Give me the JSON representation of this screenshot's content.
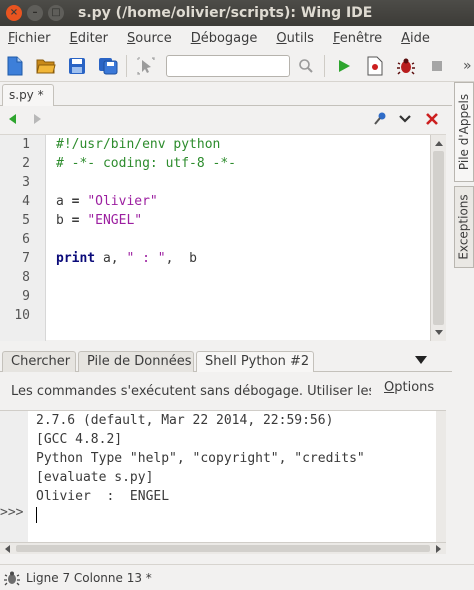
{
  "window": {
    "title": "s.py (/home/olivier/scripts): Wing IDE",
    "close_glyph": "×",
    "minimize_glyph": "–",
    "maximize_glyph": "□"
  },
  "menu": {
    "items": [
      {
        "first": "F",
        "rest": "ichier"
      },
      {
        "first": "E",
        "rest": "diter"
      },
      {
        "first": "S",
        "rest": "ource"
      },
      {
        "first": "D",
        "rest": "ébogage"
      },
      {
        "first": "O",
        "rest": "utils"
      },
      {
        "first": "F",
        "rest": "enêtre"
      },
      {
        "first": "A",
        "rest": "ide"
      }
    ]
  },
  "toolbar": {
    "search_value": "",
    "icons": [
      "new-file-icon",
      "open-folder-icon",
      "save-icon",
      "save-all-icon",
      "select-pointer-icon",
      "search-icon",
      "run-icon",
      "debug-file-icon",
      "bug-icon",
      "stop-icon"
    ],
    "overflow_glyph": "»"
  },
  "editor": {
    "tab_label": "s.py *",
    "line_numbers": [
      "1",
      "2",
      "3",
      "4",
      "5",
      "6",
      "7",
      "8",
      "9",
      "10"
    ],
    "code": {
      "l1": "#!/usr/bin/env python",
      "l2": "# -*- coding: utf-8 -*-",
      "l4_var": "a",
      "l4_eq": " = ",
      "l4_str": "\"Olivier\"",
      "l5_var": "b",
      "l5_eq": " = ",
      "l5_str": "\"ENGEL\"",
      "l7_kw": "print",
      "l7_a": " a, ",
      "l7_str": "\" : \"",
      "l7_b": ",  b"
    }
  },
  "side_tabs": {
    "call_stack": "Pile d'Appels",
    "exceptions": "Exceptions"
  },
  "lower": {
    "tabs": [
      "Chercher",
      "Pile de Données",
      "Shell Python #2"
    ],
    "info": "Les commandes s'exécutent sans débogage. Utiliser les tou",
    "options": "Options",
    "shell_lines": [
      "2.7.6 (default, Mar 22 2014, 22:59:56)",
      "[GCC 4.8.2]",
      "Python Type \"help\", \"copyright\", \"credits\"",
      "[evaluate s.py]",
      "Olivier  :  ENGEL"
    ],
    "prompt": ">>>"
  },
  "status": {
    "text": "Ligne 7 Colonne 13 *"
  },
  "colors": {
    "accent_orange": "#e95420",
    "comment": "#2d8c2d",
    "string": "#9c1fa0",
    "keyword": "#0b0b7a",
    "run_green": "#2ea52e",
    "close_red": "#cc1f1f"
  }
}
